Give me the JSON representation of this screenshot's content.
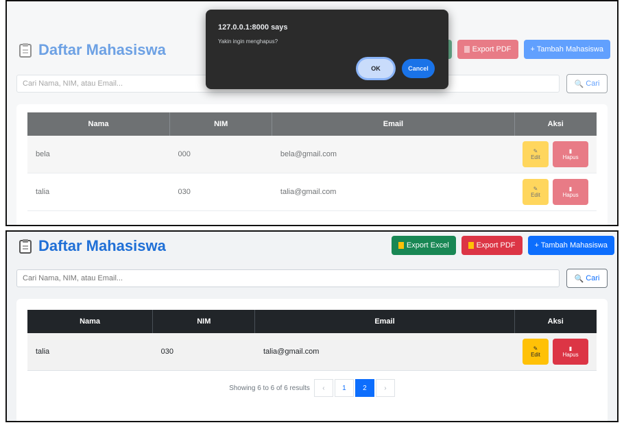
{
  "page": {
    "title": "Daftar Mahasiswa"
  },
  "toolbar": {
    "export_excel": "Export Excel",
    "export_pdf": "Export PDF",
    "add_student": "+ Tambah Mahasiswa"
  },
  "search": {
    "placeholder": "Cari Nama, NIM, atau Email...",
    "button": "Cari"
  },
  "table": {
    "headers": [
      "Nama",
      "NIM",
      "Email",
      "Aksi"
    ],
    "edit_label": "Edit",
    "delete_label": "Hapus"
  },
  "top_rows": [
    {
      "nama": "bela",
      "nim": "000",
      "email": "bela@gmail.com"
    },
    {
      "nama": "talia",
      "nim": "030",
      "email": "talia@gmail.com"
    }
  ],
  "bottom_rows": [
    {
      "nama": "talia",
      "nim": "030",
      "email": "talia@gmail.com"
    }
  ],
  "pagination": {
    "summary": "Showing 6 to 6 of 6 results",
    "prev": "‹",
    "pages": [
      "1",
      "2"
    ],
    "active": "2",
    "next": "›"
  },
  "dialog": {
    "title": "127.0.0.1:8000 says",
    "message": "Yakin ingin menghapus?",
    "ok": "OK",
    "cancel": "Cancel"
  },
  "colors": {
    "primary": "#0d6efd",
    "success": "#198754",
    "danger": "#dc3545",
    "warning": "#ffc107",
    "title": "#1f6fd6"
  },
  "icons": [
    "clipboard-icon",
    "search-icon",
    "pencil-icon",
    "trash-icon",
    "excel-icon",
    "pdf-icon"
  ]
}
